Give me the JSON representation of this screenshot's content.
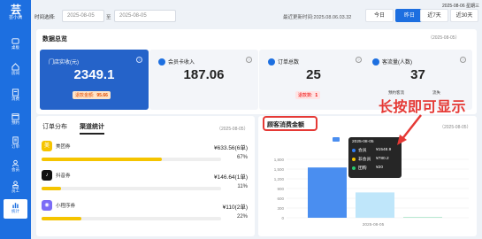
{
  "app": {
    "logo_glyph": "芸",
    "logo_name": "芸小满"
  },
  "sidebar": {
    "items": [
      {
        "label": "桌板",
        "icon": "desk-icon"
      },
      {
        "label": "房间",
        "icon": "room-icon"
      },
      {
        "label": "消费",
        "icon": "consume-icon"
      },
      {
        "label": "预约",
        "icon": "booking-icon"
      },
      {
        "label": "订单",
        "icon": "order-icon"
      },
      {
        "label": "会员",
        "icon": "member-icon"
      },
      {
        "label": "员工",
        "icon": "staff-icon"
      },
      {
        "label": "统计",
        "icon": "stats-icon",
        "active": true
      }
    ]
  },
  "topbar": {
    "timestamp": "2025-08-06 星期三",
    "time_label": "时间选择:",
    "date_start": "2025-08-05",
    "separator": "至",
    "date_end": "2025-08-05",
    "latest_update": "最近更新时间:2025.08.06.03.32",
    "quick_buttons": [
      "今日",
      "昨日",
      "近7天",
      "近30天"
    ],
    "active_quick": "昨日"
  },
  "overview": {
    "title": "数据总览",
    "date": "（2025-08-05）",
    "cards": [
      {
        "title": "门店实收(元)",
        "value": "2349.1",
        "sub_label": "退款金额:",
        "sub_value": "95.66"
      },
      {
        "title": "会员卡收入",
        "value": "187.06"
      },
      {
        "title": "订单总数",
        "value": "25",
        "sub_label": "退款数:",
        "sub_value": "1"
      },
      {
        "title": "客流量(人数)",
        "value": "37",
        "left_small": "预约客流",
        "right_small": "流失"
      }
    ]
  },
  "channels": {
    "tabs": [
      "订单分布",
      "渠道统计"
    ],
    "active_tab": "渠道统计",
    "date": "（2025-08-05）",
    "items": [
      {
        "name": "美团券",
        "amount": "¥633.56(6单)",
        "percent": "67%",
        "ratio": 0.67,
        "icon_color": "#f5c400",
        "icon_text": "美"
      },
      {
        "name": "抖音券",
        "amount": "¥146.64(1单)",
        "percent": "11%",
        "ratio": 0.11,
        "icon_color": "#111111",
        "icon_text": "♪"
      },
      {
        "name": "小程序券",
        "amount": "¥110(2单)",
        "percent": "22%",
        "ratio": 0.22,
        "icon_color": "#7b6cf6",
        "icon_text": "◉"
      }
    ]
  },
  "chart_panel": {
    "title": "顾客消费金额",
    "date": "（2025-08-05）",
    "annotation": "长按即可显示",
    "tooltip": {
      "date": "2025-08-05",
      "rows": [
        {
          "name": "会员",
          "value": "¥1548.9",
          "color": "#2f7df6"
        },
        {
          "name": "非会员",
          "value": "¥780.2",
          "color": "#f5c400"
        },
        {
          "name": "团购",
          "value": "¥20",
          "color": "#28c76f"
        }
      ]
    }
  },
  "chart_data": {
    "type": "bar",
    "categories": [
      "2025-08-05"
    ],
    "series": [
      {
        "name": "会员",
        "values": [
          1548.9
        ],
        "color": "#4a8ef0"
      },
      {
        "name": "非会员",
        "values": [
          780.2
        ],
        "color": "#bfe6fa"
      },
      {
        "name": "团购",
        "values": [
          20
        ],
        "color": "#9fe0c0"
      }
    ],
    "yticks": [
      "1,800",
      "1,500",
      "1,200",
      "900",
      "600",
      "300",
      "0"
    ],
    "ylim": [
      0,
      1800
    ],
    "xlabel": "",
    "ylabel": "",
    "grid": true
  }
}
